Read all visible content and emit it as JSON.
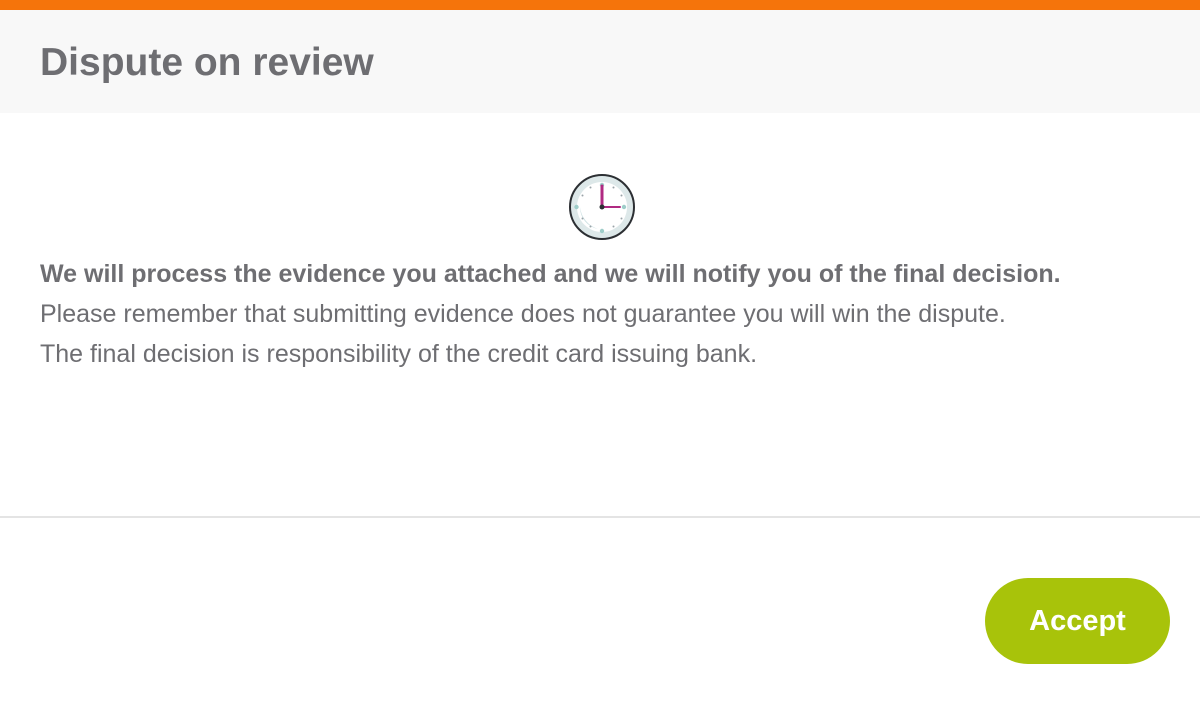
{
  "dialog": {
    "title": "Dispute on review",
    "icon": "clock-icon",
    "message_bold": "We will process the evidence you attached and we will notify you of the final decision.",
    "message_line_1": "Please remember that submitting evidence does not guarantee you will win the dispute.",
    "message_line_2": "The final decision is responsibility of the credit card issuing bank.",
    "accept_label": "Accept"
  },
  "colors": {
    "accent_bar": "#f5740b",
    "header_bg": "#f8f8f8",
    "text": "#6e6e72",
    "button_bg": "#a8c30a",
    "divider": "#e4e4e4"
  }
}
